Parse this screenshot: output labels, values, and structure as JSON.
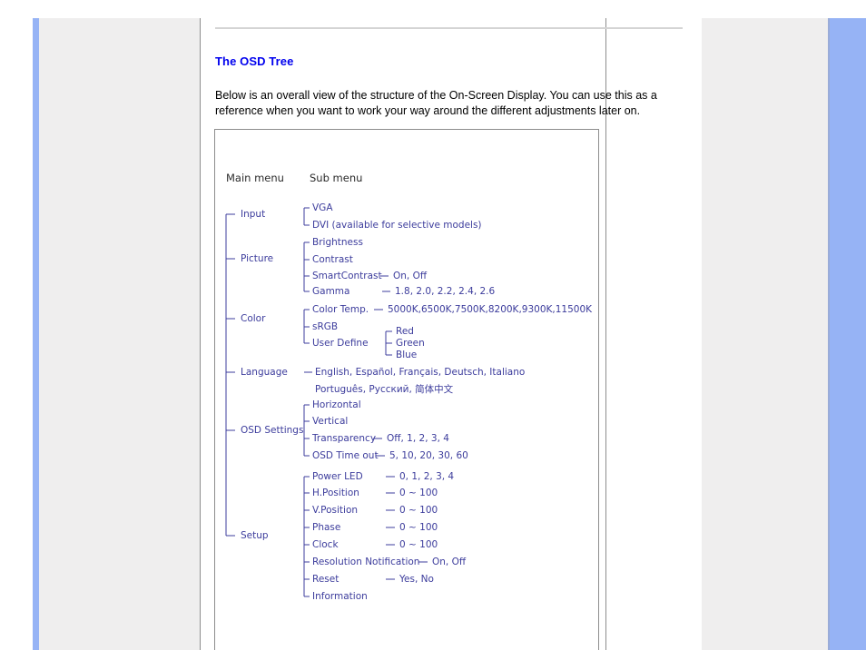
{
  "page": {
    "title": "The OSD Tree",
    "intro": "Below is an overall view of the structure of the On-Screen Display. You can use this as a reference when you want to work your way around the different adjustments later on.",
    "accent_heading_color": "#0000ee",
    "tree_text_color": "#3c3c9c",
    "sidebar_color": "#efeeee",
    "accent_bar_color": "#96b3f5"
  },
  "diagram": {
    "headers": {
      "main": "Main menu",
      "sub": "Sub menu"
    },
    "groups": [
      {
        "main": "Input",
        "items": [
          {
            "sub": "VGA",
            "values": ""
          },
          {
            "sub": "DVI (available for selective models)",
            "values": ""
          }
        ]
      },
      {
        "main": "Picture",
        "items": [
          {
            "sub": "Brightness",
            "values": ""
          },
          {
            "sub": "Contrast",
            "values": ""
          },
          {
            "sub": "SmartContrast",
            "values": "On, Off"
          },
          {
            "sub": "Gamma",
            "values": "1.8, 2.0, 2.2, 2.4, 2.6"
          }
        ]
      },
      {
        "main": "Color",
        "items": [
          {
            "sub": "Color Temp.",
            "values": "5000K,6500K,7500K,8200K,9300K,11500K"
          },
          {
            "sub": "sRGB",
            "values": ""
          },
          {
            "sub": "User Define",
            "values": ""
          }
        ],
        "subsub": [
          "Red",
          "Green",
          "Blue"
        ]
      },
      {
        "main": "Language",
        "items": [
          {
            "sub": "English, Español, Français, Deutsch, Italiano",
            "values": ""
          },
          {
            "sub": "Português, Русский, 简体中文",
            "values": ""
          }
        ]
      },
      {
        "main": "OSD Settings",
        "items": [
          {
            "sub": "Horizontal",
            "values": ""
          },
          {
            "sub": "Vertical",
            "values": ""
          },
          {
            "sub": "Transparency",
            "values": "Off, 1, 2, 3, 4"
          },
          {
            "sub": "OSD Time out",
            "values": "5, 10, 20, 30, 60"
          }
        ]
      },
      {
        "main": "Setup",
        "items": [
          {
            "sub": "Power LED",
            "values": "0, 1, 2, 3, 4"
          },
          {
            "sub": "H.Position",
            "values": "0 ~ 100"
          },
          {
            "sub": "V.Position",
            "values": "0 ~ 100"
          },
          {
            "sub": "Phase",
            "values": "0 ~ 100"
          },
          {
            "sub": "Clock",
            "values": "0 ~ 100"
          },
          {
            "sub": "Resolution Notification",
            "values": "On, Off"
          },
          {
            "sub": "Reset",
            "values": "Yes, No"
          },
          {
            "sub": "Information",
            "values": ""
          }
        ]
      }
    ]
  }
}
